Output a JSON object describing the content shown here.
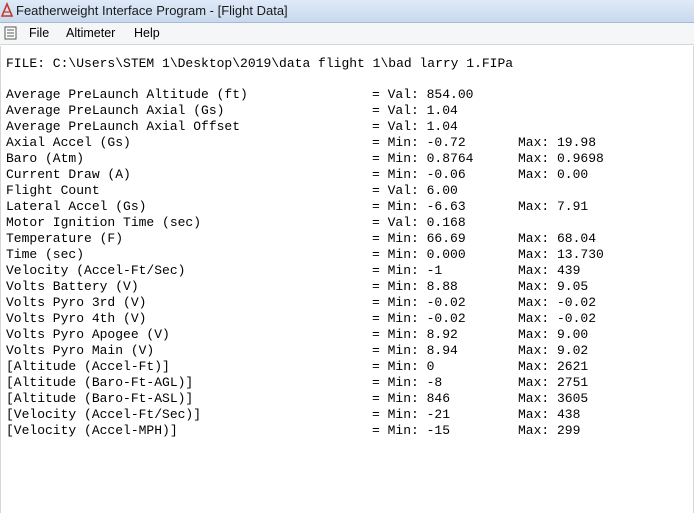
{
  "window": {
    "title": "Featherweight Interface Program - [Flight Data]"
  },
  "menu": {
    "items": [
      "File",
      "Altimeter",
      "Help"
    ]
  },
  "file_line": "FILE: C:\\Users\\STEM 1\\Desktop\\2019\\data flight 1\\bad larry 1.FIPa",
  "rows": [
    {
      "name": "Average PreLaunch Altitude (ft)",
      "v1": "= Val: 854.00",
      "v2": ""
    },
    {
      "name": "Average PreLaunch Axial (Gs)",
      "v1": "= Val: 1.04",
      "v2": ""
    },
    {
      "name": "Average PreLaunch Axial Offset",
      "v1": "= Val: 1.04",
      "v2": ""
    },
    {
      "name": "Axial Accel (Gs)",
      "v1": "= Min: -0.72",
      "v2": "Max: 19.98"
    },
    {
      "name": "Baro (Atm)",
      "v1": "= Min: 0.8764",
      "v2": "Max: 0.9698"
    },
    {
      "name": "Current Draw (A)",
      "v1": "= Min: -0.06",
      "v2": "Max: 0.00"
    },
    {
      "name": "Flight Count",
      "v1": "= Val: 6.00",
      "v2": ""
    },
    {
      "name": "Lateral Accel (Gs)",
      "v1": "= Min: -6.63",
      "v2": "Max: 7.91"
    },
    {
      "name": "Motor Ignition Time (sec)",
      "v1": "= Val: 0.168",
      "v2": ""
    },
    {
      "name": "Temperature (F)",
      "v1": "= Min: 66.69",
      "v2": "Max: 68.04"
    },
    {
      "name": "Time (sec)",
      "v1": "= Min: 0.000",
      "v2": "Max: 13.730"
    },
    {
      "name": "Velocity (Accel-Ft/Sec)",
      "v1": "= Min: -1",
      "v2": "Max: 439"
    },
    {
      "name": "Volts Battery (V)",
      "v1": "= Min: 8.88",
      "v2": "Max: 9.05"
    },
    {
      "name": "Volts Pyro 3rd (V)",
      "v1": "= Min: -0.02",
      "v2": "Max: -0.02"
    },
    {
      "name": "Volts Pyro 4th (V)",
      "v1": "= Min: -0.02",
      "v2": "Max: -0.02"
    },
    {
      "name": "Volts Pyro Apogee (V)",
      "v1": "= Min: 8.92",
      "v2": "Max: 9.00"
    },
    {
      "name": "Volts Pyro Main (V)",
      "v1": "= Min: 8.94",
      "v2": "Max: 9.02"
    },
    {
      "name": "[Altitude (Accel-Ft)]",
      "v1": "= Min: 0",
      "v2": "Max: 2621"
    },
    {
      "name": "[Altitude (Baro-Ft-AGL)]",
      "v1": "= Min: -8",
      "v2": "Max: 2751"
    },
    {
      "name": "[Altitude (Baro-Ft-ASL)]",
      "v1": "= Min: 846",
      "v2": "Max: 3605"
    },
    {
      "name": "[Velocity (Accel-Ft/Sec)]",
      "v1": "= Min: -21",
      "v2": "Max: 438"
    },
    {
      "name": "[Velocity (Accel-MPH)]",
      "v1": "= Min: -15",
      "v2": "Max: 299"
    }
  ],
  "icons": {
    "app": "feather-app-icon",
    "doc": "document-icon"
  },
  "colors": {
    "titlebar": "#c9d9ee",
    "menubar": "#f5f6f7",
    "background": "#ffffff"
  }
}
